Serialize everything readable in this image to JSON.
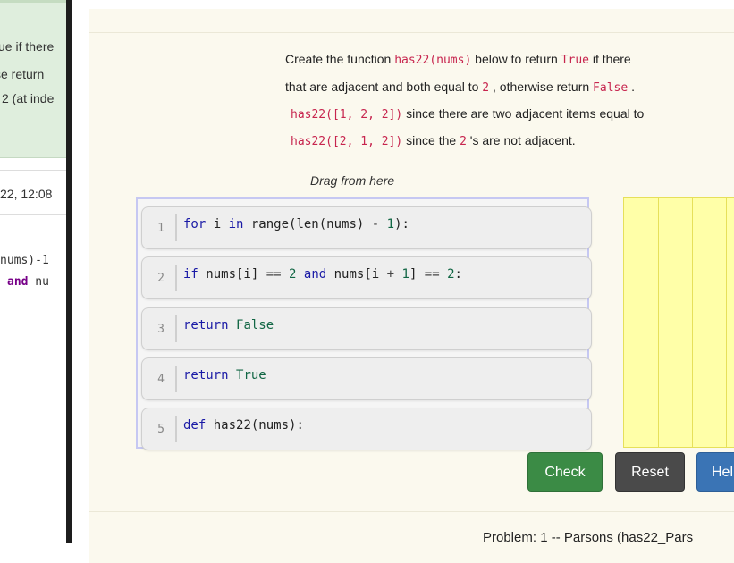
{
  "background": {
    "green_lines": [
      "ue if there",
      "se return",
      "2 (at inde"
    ],
    "timestamp": "22, 12:08",
    "code_line1": "nums)-1",
    "code_line2_kw": "and",
    "code_line2_rest": " nu"
  },
  "problem": {
    "desc_line1_a": "Create the function ",
    "desc_line1_code": "has22(nums)",
    "desc_line1_b": " below to return ",
    "desc_line1_true": "True",
    "desc_line1_c": " if there",
    "desc_line2_a": "that are adjacent and both equal to ",
    "desc_line2_two": "2",
    "desc_line2_b": " , otherwise return ",
    "desc_line2_false": "False",
    "desc_line2_c": " .",
    "desc_line3_code": "has22([1, 2, 2])",
    "desc_line3_b": " since there are two adjacent items equal to",
    "desc_line4_code": "has22([2, 1, 2])",
    "desc_line4_b": " since the ",
    "desc_line4_two": "2",
    "desc_line4_c": " 's are not adjacent."
  },
  "drag_label": "Drag from here",
  "blocks": [
    {
      "num": "1",
      "text": "for i in range(len(nums) - 1):"
    },
    {
      "num": "2",
      "text": "if nums[i] == 2 and nums[i + 1] == 2:"
    },
    {
      "num": "3",
      "text": "return False"
    },
    {
      "num": "4",
      "text": "return True"
    },
    {
      "num": "5",
      "text": "def has22(nums):"
    }
  ],
  "buttons": {
    "check": "Check",
    "reset": "Reset",
    "help": "Hel"
  },
  "footer": {
    "problem_label": "Problem: 1 -- Parsons (has22_Pars"
  },
  "colors": {
    "check": "#3b8b45",
    "reset": "#4a4a4a",
    "help": "#3a74b5",
    "answer_area": "#ffffa8",
    "code_highlight": "#c7254e"
  }
}
